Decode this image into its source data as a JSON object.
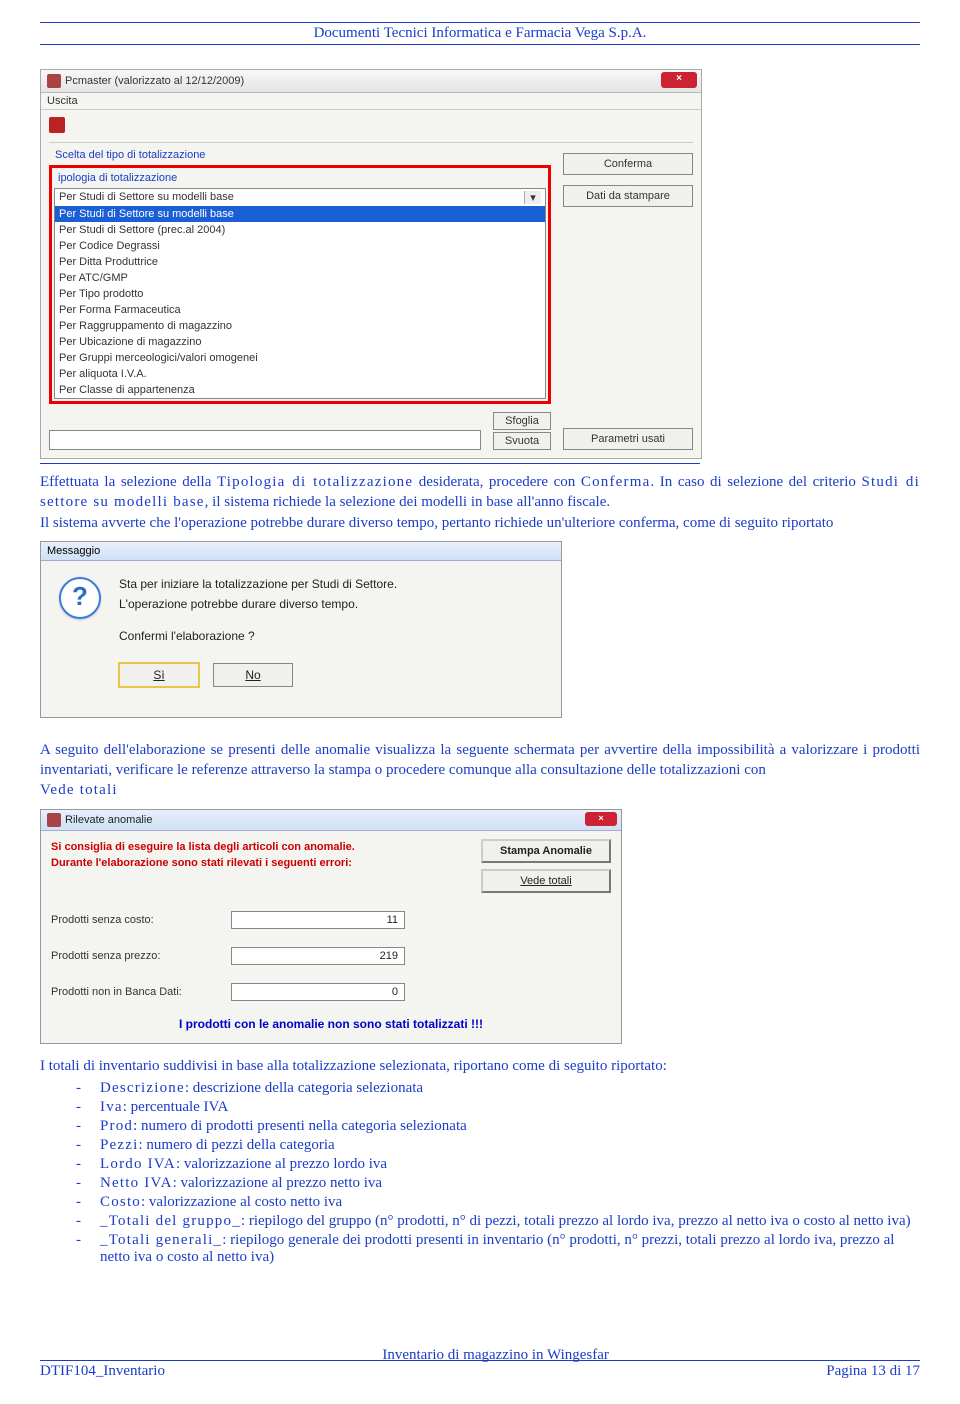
{
  "header": "Documenti Tecnici Informatica e Farmacia Vega S.p.A.",
  "win1": {
    "title": "Pcmaster (valorizzato al 12/12/2009)",
    "menu": "Uscita",
    "group": "Scelta del tipo di totalizzazione",
    "ipo_label": "ipologia di totalizzazione",
    "opts": [
      "Per Studi di Settore su modelli base",
      "Per Studi di Settore su modelli base",
      "Per Studi di Settore (prec.al 2004)",
      "Per Codice Degrassi",
      "Per Ditta Produttrice",
      "Per ATC/GMP",
      "Per Tipo prodotto",
      "Per Forma Farmaceutica",
      "Per Raggruppamento di magazzino",
      "Per Ubicazione di magazzino",
      "Per Gruppi merceologici/valori omogenei",
      "Per aliquota I.V.A.",
      "Per Classe di appartenenza"
    ],
    "btn_conf": "Conferma",
    "btn_dati": "Dati da stampare",
    "btn_sfoglia": "Sfoglia",
    "btn_svuota": "Svuota",
    "btn_param": "Parametri usati"
  },
  "para1_a": "Effettuata la selezione della ",
  "para1_b": "Tipologia di totalizzazione",
  "para1_c": " desiderata, procedere con ",
  "para1_d": "Conferma",
  "para1_e": ". In caso di selezione del criterio ",
  "para1_f": "Studi di settore su modelli base",
  "para1_g": ", il sistema richiede la selezione dei modelli in base all'anno fiscale.",
  "para1_h": "Il sistema avverte che l'operazione potrebbe durare diverso tempo, pertanto richiede un'ulteriore conferma, come di seguito riportato",
  "msg": {
    "title": "Messaggio",
    "l1": "Sta per iniziare la totalizzazione per Studi di Settore.",
    "l2": "L'operazione potrebbe durare diverso tempo.",
    "l3": "Confermi l'elaborazione ?",
    "si": "Sì",
    "no": "No"
  },
  "para2_a": "A seguito dell'elaborazione se presenti delle anomalie visualizza la seguente schermata per avvertire della impossibilità a valorizzare i prodotti inventariati, verificare le referenze attraverso la stampa o procedere comunque alla consultazione delle totalizzazioni con ",
  "para2_b": "Vede totali",
  "anom": {
    "title": "Rilevate anomalie",
    "m1": "Si consiglia di eseguire la lista degli articoli con anomalie.",
    "m2": "Durante l'elaborazione sono stati rilevati i seguenti errori:",
    "btn_stampa": "Stampa Anomalie",
    "btn_vede": "Vede totali",
    "r1_l": "Prodotti senza costo:",
    "r1_v": "11",
    "r2_l": "Prodotti senza prezzo:",
    "r2_v": "219",
    "r3_l": "Prodotti non in Banca Dati:",
    "r3_v": "0",
    "warn": "I prodotti con le anomalie non sono stati totalizzati !!!"
  },
  "para3": "I totali di inventario suddivisi in base alla totalizzazione selezionata,  riportano come di seguito riportato:",
  "list": [
    {
      "t": "Descrizione",
      "d": ": descrizione della categoria selezionata"
    },
    {
      "t": "Iva",
      "d": ": percentuale IVA"
    },
    {
      "t": "Prod",
      "d": ": numero di prodotti presenti nella categoria selezionata"
    },
    {
      "t": "Pezzi",
      "d": ": numero di pezzi della categoria"
    },
    {
      "t": "Lordo IVA",
      "d": ": valorizzazione al prezzo lordo iva"
    },
    {
      "t": "Netto IVA",
      "d": ": valorizzazione al prezzo netto iva"
    },
    {
      "t": "Costo",
      "d": ": valorizzazione al costo netto iva"
    },
    {
      "t": "_Totali del gruppo_",
      "d": ": riepilogo del gruppo (n° prodotti, n° di pezzi, totali prezzo al lordo iva, prezzo al netto iva o costo al netto iva)"
    },
    {
      "t": "_Totali generali_",
      "d": ": riepilogo generale dei prodotti presenti in inventario (n° prodotti, n° prezzi, totali prezzo al lordo iva, prezzo al netto iva o costo al netto iva)"
    }
  ],
  "footer": {
    "left": "DTIF104_Inventario",
    "center": "Inventario di magazzino in Wingesfar",
    "right": "Pagina 13 di 17"
  }
}
